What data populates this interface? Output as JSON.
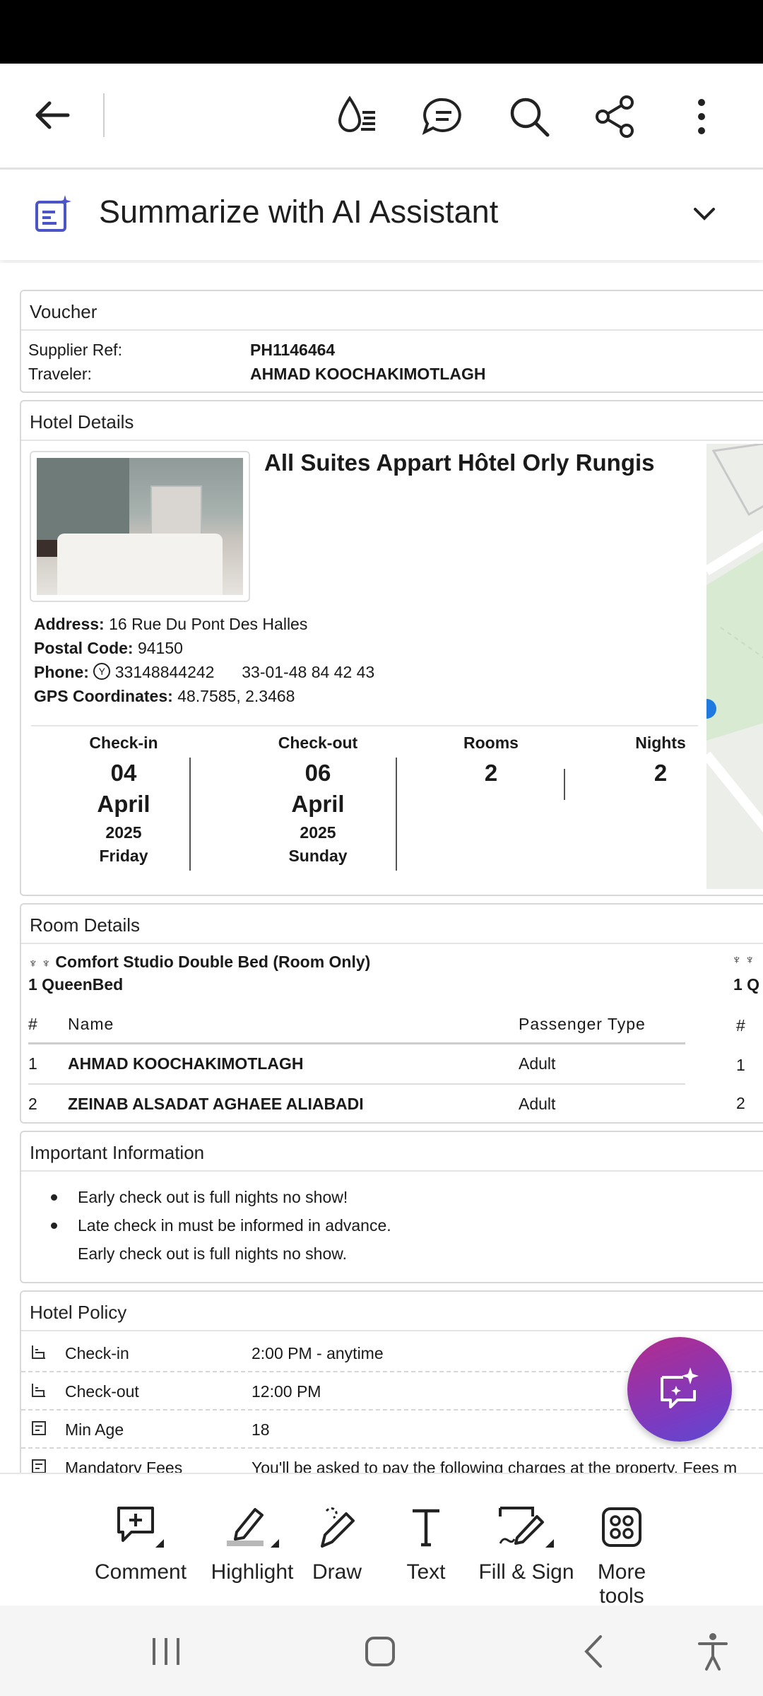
{
  "topbar": {
    "icons": [
      "back-arrow-icon",
      "read-aloud-icon",
      "comments-icon",
      "search-icon",
      "share-icon",
      "more-vert-icon"
    ]
  },
  "ai_assistant": {
    "title": "Summarize with AI Assistant"
  },
  "voucher": {
    "heading": "Voucher",
    "supplier_ref_label": "Supplier Ref:",
    "supplier_ref": "PH1146464",
    "traveler_label": "Traveler:",
    "traveler": "AHMAD KOOCHAKIMOTLAGH"
  },
  "hotel": {
    "heading": "Hotel Details",
    "name": "All Suites Appart Hôtel Orly Rungis",
    "address_label": "Address:",
    "address": "16 Rue Du Pont Des Halles",
    "postal_label": "Postal Code:",
    "postal": "94150",
    "phone_label": "Phone:",
    "phone_1": "33148844242",
    "phone_2": "33-01-48 84 42 43",
    "gps_label": "GPS Coordinates:",
    "gps": "48.7585, 2.3468"
  },
  "stay": {
    "checkin_label": "Check-in",
    "checkin_day": "04",
    "checkin_month": "April",
    "checkin_year": "2025",
    "checkin_weekday": "Friday",
    "checkout_label": "Check-out",
    "checkout_day": "06",
    "checkout_month": "April",
    "checkout_year": "2025",
    "checkout_weekday": "Sunday",
    "rooms_label": "Rooms",
    "rooms": "2",
    "nights_label": "Nights",
    "nights": "2"
  },
  "rooms": {
    "heading": "Room Details",
    "room_name": "Comfort Studio Double Bed (Room Only)",
    "bed": "1 QueenBed",
    "bed_partial": "1 Q",
    "col_num": "#",
    "col_name": "Name",
    "col_type": "Passenger Type",
    "guests": [
      {
        "num": "1",
        "name": "AHMAD KOOCHAKIMOTLAGH",
        "type": "Adult"
      },
      {
        "num": "2",
        "name": "ZEINAB ALSADAT AGHAEE ALIABADI",
        "type": "Adult"
      }
    ]
  },
  "important": {
    "heading": "Important Information",
    "items": [
      "Early check out is full nights no show!",
      "Late check in must be informed in advance.",
      "Early check out is full nights no show."
    ]
  },
  "policy": {
    "heading": "Hotel Policy",
    "rows": [
      {
        "key": "Check-in",
        "value": "2:00 PM - anytime"
      },
      {
        "key": "Check-out",
        "value": "12:00 PM"
      },
      {
        "key": "Min Age",
        "value": "18"
      },
      {
        "key": "Mandatory Fees",
        "value": "You'll be asked to pay the following charges at the property. Fees m"
      }
    ]
  },
  "toolbar": {
    "comment": "Comment",
    "highlight": "Highlight",
    "draw": "Draw",
    "text": "Text",
    "fill_sign": "Fill & Sign",
    "more_tools": "More tools"
  },
  "colors": {
    "fab_gradient_start": "#b42b8c",
    "fab_gradient_end": "#5b4ad1",
    "ai_icon": "#4b55c8"
  }
}
